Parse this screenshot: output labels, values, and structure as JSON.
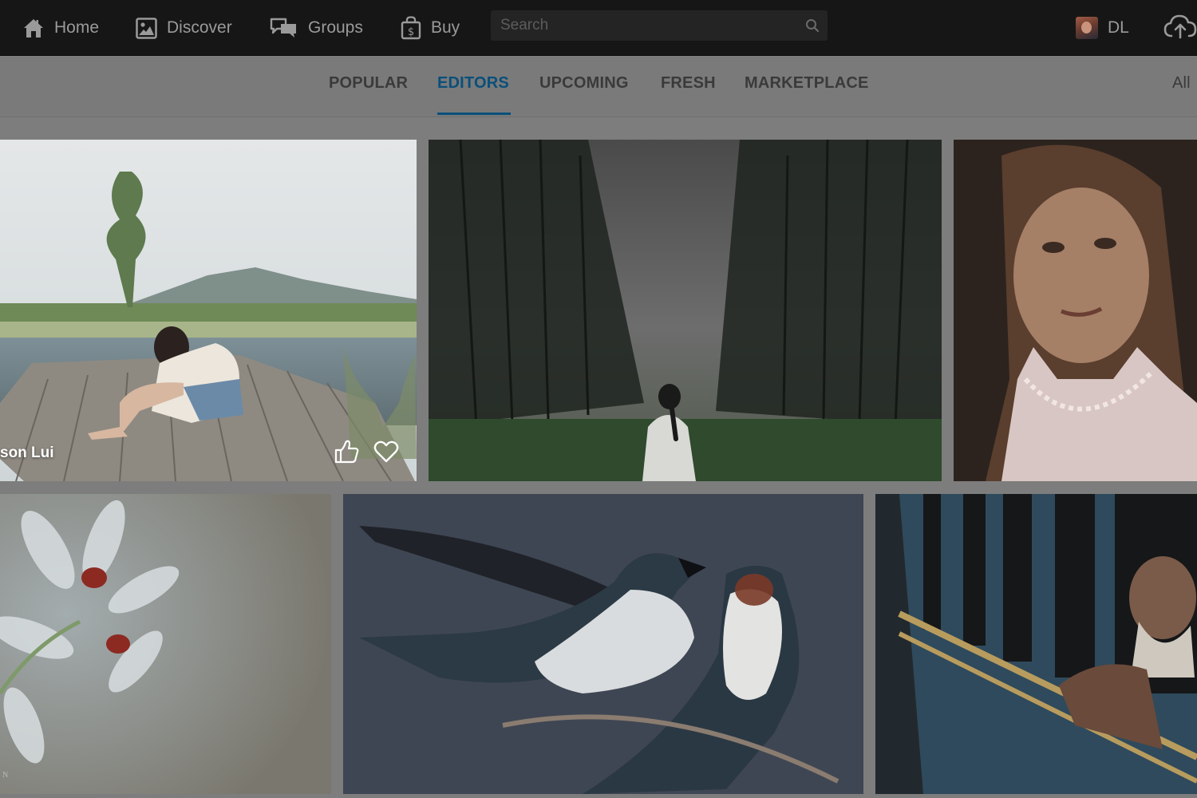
{
  "nav": {
    "home": {
      "label": "Home",
      "icon": "home-icon"
    },
    "discover": {
      "label": "Discover",
      "icon": "image-icon"
    },
    "groups": {
      "label": "Groups",
      "icon": "chat-bubbles-icon"
    },
    "buy": {
      "label": "Buy",
      "icon": "shopping-bag-icon"
    }
  },
  "search": {
    "placeholder": "Search",
    "value": ""
  },
  "user": {
    "initials": "DL"
  },
  "tabs": {
    "items": [
      {
        "label": "POPULAR",
        "active": false
      },
      {
        "label": "EDITORS",
        "active": true
      },
      {
        "label": "UPCOMING",
        "active": false
      },
      {
        "label": "FRESH",
        "active": false
      },
      {
        "label": "MARKETPLACE",
        "active": false
      }
    ],
    "all_label": "All"
  },
  "photos": [
    {
      "caption": "son Lui",
      "subject": "woman sitting on wooden dock by lake"
    },
    {
      "subject": "girl in misty pine forest"
    },
    {
      "subject": "portrait of young girl"
    },
    {
      "watermark": "N",
      "subject": "ladybugs on white flowers"
    },
    {
      "subject": "two swallows on branch"
    },
    {
      "subject": "man leaning from train window"
    }
  ],
  "colors": {
    "topbar_bg": "#161616",
    "accent": "#0a4f7a",
    "nav_text": "#9a9a9a",
    "tab_text": "#3a3a3a",
    "page_bg": "#7d7d7d"
  }
}
